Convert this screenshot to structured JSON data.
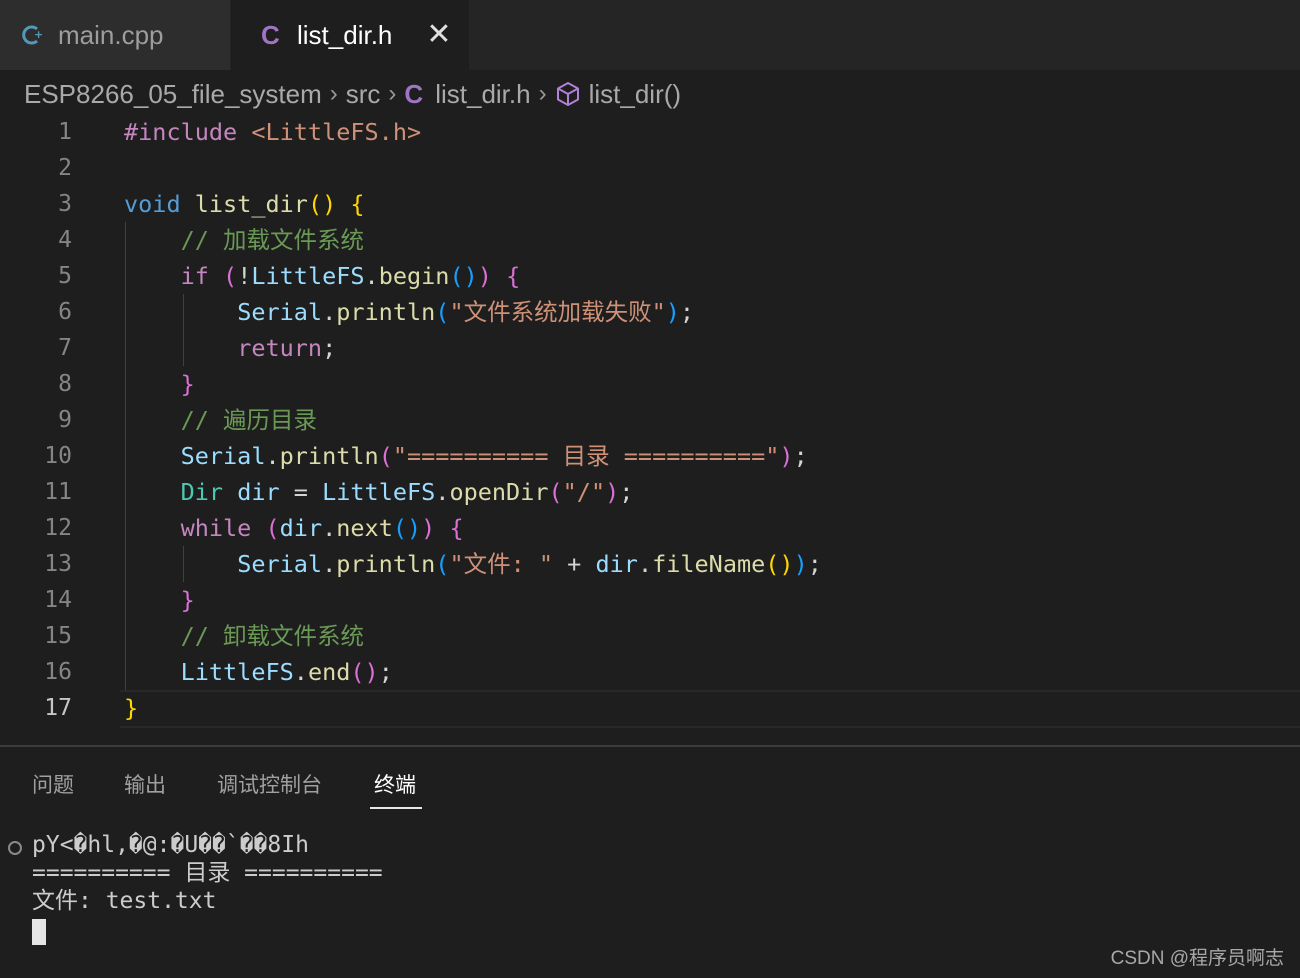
{
  "tabs": [
    {
      "label": "main.cpp",
      "icon": "cpp-file-icon",
      "active": false
    },
    {
      "label": "list_dir.h",
      "icon": "c-file-icon",
      "active": true
    }
  ],
  "breadcrumb": {
    "project": "ESP8266_05_file_system",
    "folder": "src",
    "file": "list_dir.h",
    "symbol": "list_dir()"
  },
  "editor": {
    "line_numbers": [
      "1",
      "2",
      "3",
      "4",
      "5",
      "6",
      "7",
      "8",
      "9",
      "10",
      "11",
      "12",
      "13",
      "14",
      "15",
      "16",
      "17"
    ],
    "current_line": "17",
    "code_lines": [
      "#include <LittleFS.h>",
      "",
      "void list_dir() {",
      "    // 加载文件系统",
      "    if (!LittleFS.begin()) {",
      "        Serial.println(\"文件系统加载失败\");",
      "        return;",
      "    }",
      "    // 遍历目录",
      "    Serial.println(\"========== 目录 ==========\");",
      "    Dir dir = LittleFS.openDir(\"/\");",
      "    while (dir.next()) {",
      "        Serial.println(\"文件: \" + dir.fileName());",
      "    }",
      "    // 卸载文件系统",
      "    LittleFS.end();",
      "}"
    ]
  },
  "panel": {
    "tabs": [
      "问题",
      "输出",
      "调试控制台",
      "终端"
    ],
    "active_tab": "终端",
    "terminal_lines": [
      "pY<�hl,�@:�U��`��8Ih",
      "========== 目录 ==========",
      "文件: test.txt"
    ]
  },
  "watermark": "CSDN @程序员啊志"
}
